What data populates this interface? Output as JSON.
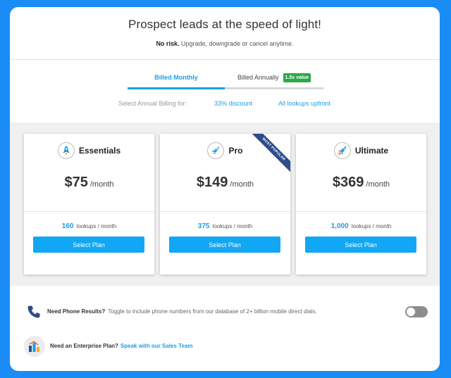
{
  "header": {
    "title": "Prospect leads at the speed of light!",
    "subtitle_bold": "No risk.",
    "subtitle_rest": "Upgrade, downgrade or cancel anytime."
  },
  "billing": {
    "tabs": [
      {
        "label": "Billed Monthly",
        "active": true
      },
      {
        "label": "Billed Annually",
        "active": false
      }
    ],
    "annual_badge": "1.5x value",
    "annual_label": "Select Annual Billing for:",
    "annual_options": [
      "33% discount",
      "All lookups upfront"
    ]
  },
  "plans": [
    {
      "name": "Essentials",
      "price": "$75",
      "period": "/month",
      "lookups_count": "160",
      "lookups_label": "lookups / month",
      "button": "Select Plan",
      "icon": "rocket-icon"
    },
    {
      "name": "Pro",
      "price": "$149",
      "period": "/month",
      "lookups_count": "375",
      "lookups_label": "lookups / month",
      "button": "Select Plan",
      "icon": "rocket-flying-icon",
      "ribbon": "MOST POPULAR"
    },
    {
      "name": "Ultimate",
      "price": "$369",
      "period": "/month",
      "lookups_count": "1,000",
      "lookups_label": "lookups / month",
      "button": "Select Plan",
      "icon": "rocket-launch-icon"
    }
  ],
  "phone": {
    "bold": "Need Phone Results?",
    "text": "Toggle to include phone numbers from our database of 2+ billion mobile direct dials.",
    "toggle_on": false,
    "icon": "phone-icon"
  },
  "enterprise": {
    "bold": "Need an Enterprise Plan?",
    "link": "Speak with our Sales Team",
    "icon": "building-chart-icon"
  },
  "colors": {
    "background": "#1a8cf5",
    "accent": "#1a9ee8",
    "button": "#12a7f5",
    "badge": "#2ca84a",
    "ribbon": "#2d4c8a"
  }
}
